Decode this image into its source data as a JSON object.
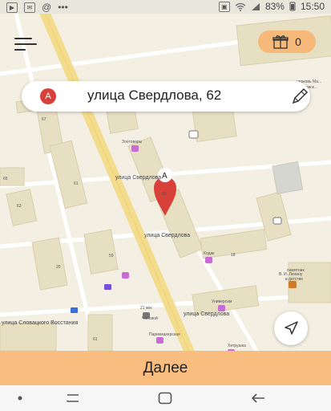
{
  "status_bar": {
    "battery": "83%",
    "time": "15:50",
    "left_icons": [
      "youtube-icon",
      "mail-icon",
      "at-icon",
      "more-icon"
    ],
    "right_icons": [
      "image-icon",
      "wifi-icon",
      "signal-icon",
      "battery-icon"
    ]
  },
  "header": {
    "menu_icon": "hamburger-icon",
    "gift_count": "0",
    "gift_icon": "gift-icon"
  },
  "address": {
    "badge": "A",
    "text": "улица Свердлова, 62",
    "edit_icon": "pencil-icon"
  },
  "map": {
    "pin_label": "A",
    "labels": {
      "street_main": "улица Свердлова",
      "street_lower": "улица Свердлова",
      "street_slov": "улица Словацкого Восстания",
      "zoo": "Зоотовары",
      "kodak": "Кодак",
      "universam": "Универсам",
      "chasovoy": "Часовой",
      "parikmaher": "Парикмахерская",
      "century": "21 век",
      "khitrushka": "Хитрушка",
      "pamyatnik": "памятник",
      "lenin": "В. И. Ленину",
      "detstve": "в детстве",
      "tsekov": "церковь Ма...",
      "moskov": "Московск...",
      "address_bottom": "улица Свердлова",
      "house_numbers": [
        "67",
        "65",
        "61",
        "63",
        "62",
        "59",
        "20",
        "18",
        "61"
      ]
    },
    "colors": {
      "background": "#f3efe2",
      "building": "#e7dfc2",
      "main_road": "#f3dc8c",
      "pin": "#d8413a",
      "accent": "#f9bd7f"
    }
  },
  "nav_button_icon": "navigation-arrow-icon",
  "bottom_button": "Далее",
  "system_nav": {
    "icons": [
      "dot-icon",
      "recent-apps-icon",
      "home-icon",
      "back-icon"
    ]
  }
}
